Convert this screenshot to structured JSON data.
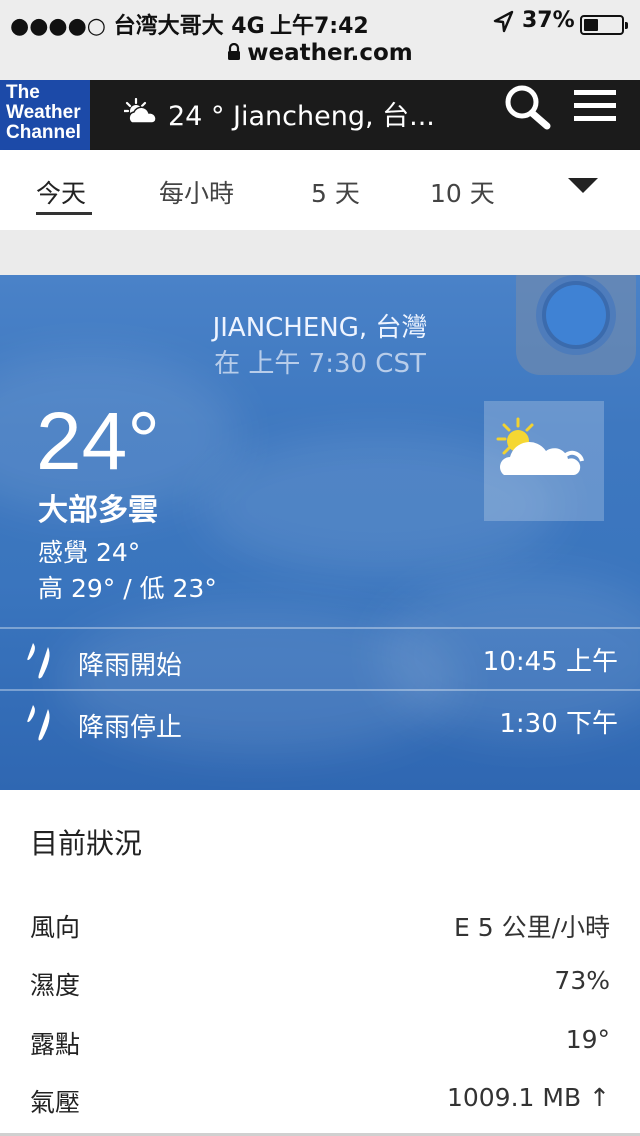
{
  "status_bar": {
    "carrier": "●●●●○ 台湾大哥大   4G",
    "time": "上午7:42",
    "battery": "37%",
    "battery_level": 0.37,
    "url": "weather.com"
  },
  "header": {
    "logo_lines": [
      "The",
      "Weather",
      "Channel"
    ],
    "current_text": "24 ° Jiancheng, 台..."
  },
  "tabs": [
    {
      "label": "今天"
    },
    {
      "label": "每小時"
    },
    {
      "label": "5 天"
    },
    {
      "label": "10 天"
    }
  ],
  "hero": {
    "location": "JIANCHENG, 台灣",
    "obs_time": "在 上午 7:30 CST",
    "temperature": "24°",
    "condition": "大部多雲",
    "feels_like": "感覺 24°",
    "hi_lo": "高 29° / 低 23°",
    "rain": [
      {
        "label": "降雨開始",
        "value": "10:45 上午"
      },
      {
        "label": "降雨停止",
        "value": "1:30 下午"
      }
    ]
  },
  "current_conditions": {
    "title": "目前狀況",
    "rows": [
      {
        "key": "風向",
        "value": "E 5 公里/小時"
      },
      {
        "key": "濕度",
        "value": "73%"
      },
      {
        "key": "露點",
        "value": "19°"
      },
      {
        "key": "氣壓",
        "value": "1009.1 MB ↑"
      }
    ]
  },
  "colors": {
    "logo_bg": "#1c4aa8",
    "header_bg": "#1b1b1b",
    "hero_blue": "#3a75be"
  }
}
